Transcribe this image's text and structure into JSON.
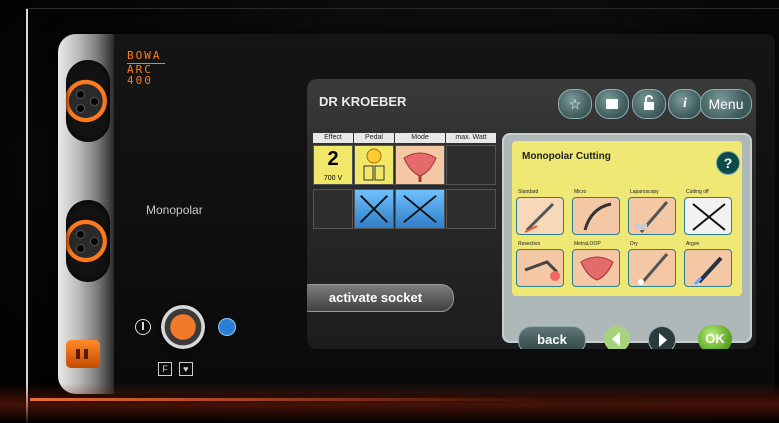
{
  "device": {
    "brand_lines": [
      "BOWA",
      "ARC",
      "400"
    ],
    "mode_label": "Monopolar"
  },
  "screen": {
    "user": "DR KROEBER",
    "header_buttons": {
      "favorites": "☆",
      "book": "",
      "lock": "",
      "info": "i",
      "menu": "Menu"
    },
    "grid": {
      "columns": [
        "Effect",
        "Pedal",
        "Mode",
        "max. Watt"
      ],
      "row1": {
        "effect_value": "2",
        "effect_voltage": "700 V"
      }
    },
    "activate_socket": "activate socket",
    "panel": {
      "title": "Monopolar Cutting",
      "help": "?",
      "options_row1": [
        "Standard",
        "Micro",
        "Laparoscopy",
        "Cutting off"
      ],
      "options_row2": [
        "Resection",
        "MetraLOOP",
        "Dry",
        "Argon"
      ],
      "back": "back",
      "ok": "OK"
    }
  },
  "colors": {
    "accent_orange": "#ff7a1e",
    "panel_yellow": "#efe874",
    "teal_button": "#3c5858",
    "ok_green": "#57a21f"
  },
  "icons": {
    "favorites": "star-icon",
    "book": "book-icon",
    "lock": "lock-icon",
    "info": "info-icon",
    "help": "help-icon",
    "prev": "chevron-left-icon",
    "next": "chevron-right-icon",
    "pedal": "pedal-icon",
    "mode": "uterus-icon",
    "cut_off": "x-icon",
    "standby": "power-icon"
  }
}
